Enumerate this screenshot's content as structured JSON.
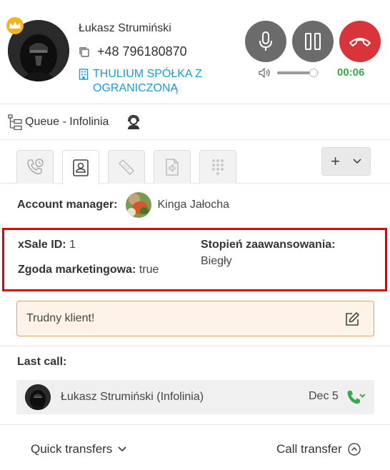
{
  "caller": {
    "name": "Łukasz Strumiński",
    "phone": "+48 796180870",
    "company": "THULIUM SPÓŁKA Z OGRANICZONĄ"
  },
  "call": {
    "timer": "00:06",
    "volume_level": 0.88
  },
  "queue": {
    "label": "Queue - Infolinia"
  },
  "tabs": [
    {
      "icon": "phone-history-icon",
      "active": false
    },
    {
      "icon": "contact-card-icon",
      "active": true
    },
    {
      "icon": "ticket-icon",
      "active": false
    },
    {
      "icon": "audio-file-icon",
      "active": false
    },
    {
      "icon": "dialpad-icon",
      "active": false
    }
  ],
  "account_manager": {
    "label": "Account manager:",
    "name": "Kinga Jałocha"
  },
  "fields": {
    "xsale_label": "xSale ID:",
    "xsale_value": "1",
    "zgoda_label": "Zgoda marketingowa:",
    "zgoda_value": "true",
    "stopien_label": "Stopień zaawansowania:",
    "stopien_value": "Biegły"
  },
  "note": {
    "text": "Trudny klient!"
  },
  "last_call": {
    "label": "Last call:",
    "name": "Łukasz Strumiński (Infolinia)",
    "date": "Dec 5"
  },
  "footer": {
    "quick_transfers": "Quick transfers",
    "call_transfer": "Call transfer"
  },
  "colors": {
    "link": "#1a9bd7",
    "hangup": "#d9343a",
    "timer": "#3aa84a",
    "highlight": "#e10000",
    "note_bg": "#fef3e6"
  }
}
